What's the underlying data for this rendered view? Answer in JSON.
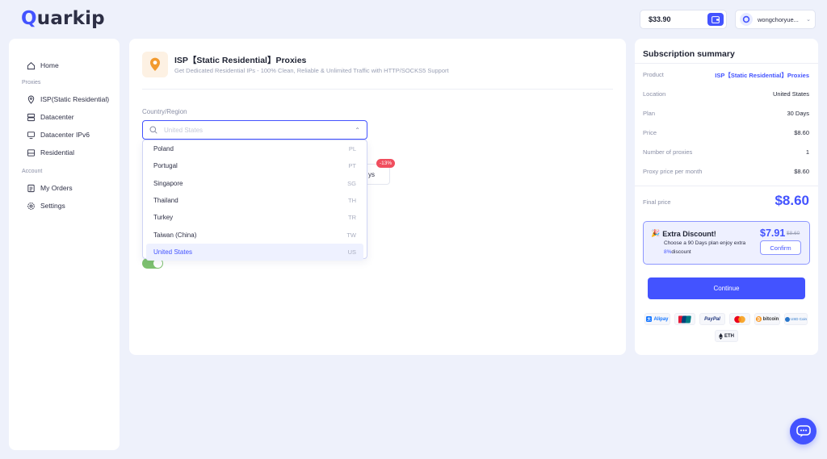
{
  "brand": {
    "logo_first": "Q",
    "logo_rest": "uarkip"
  },
  "header": {
    "balance": "$33.90",
    "username": "wongchoryue..."
  },
  "sidebar": {
    "home": "Home",
    "proxies_section": "Proxies",
    "isp": "ISP(Static Residential)",
    "datacenter": "Datacenter",
    "datacenter_ipv6": "Datacenter IPv6",
    "residential": "Residential",
    "account_section": "Account",
    "orders": "My Orders",
    "settings": "Settings"
  },
  "product": {
    "title": "ISP【Static Residential】Proxies",
    "subtitle": "Get Dedicated Residential IPs - 100% Clean, Reliable & Unlimited Traffic with HTTP/SOCKS5 Support"
  },
  "country": {
    "label": "Country/Region",
    "placeholder": "United States",
    "options": [
      {
        "name": "Poland",
        "code": "PL"
      },
      {
        "name": "Portugal",
        "code": "PT"
      },
      {
        "name": "Singapore",
        "code": "SG"
      },
      {
        "name": "Thailand",
        "code": "TH"
      },
      {
        "name": "Turkey",
        "code": "TR"
      },
      {
        "name": "Taiwan (China)",
        "code": "TW"
      },
      {
        "name": "United States",
        "code": "US"
      }
    ],
    "selected": "US"
  },
  "plan_card": {
    "label_partial": "ys",
    "badge": "-13%"
  },
  "toggle": {
    "on": true
  },
  "summary": {
    "title": "Subscription summary",
    "rows": {
      "product": {
        "k": "Product",
        "v": "ISP【Static Residential】Proxies"
      },
      "location": {
        "k": "Location",
        "v": "United States"
      },
      "plan": {
        "k": "Plan",
        "v": "30 Days"
      },
      "price": {
        "k": "Price",
        "v": "$8.60"
      },
      "num": {
        "k": "Number of proxies",
        "v": "1"
      },
      "ppm": {
        "k": "Proxy price per month",
        "v": "$8.60"
      }
    },
    "final_k": "Final price",
    "final_v": "$8.60"
  },
  "discount": {
    "title": "Extra Discount!",
    "line1": "Choose a 90 Days plan enjoy extra",
    "pct": "8%",
    "line2_rest": "discount",
    "price": "$7.91",
    "old_price": "$8.60",
    "confirm": "Confirm"
  },
  "continue_label": "Continue",
  "payments": {
    "alipay": "Alipay",
    "paypal": "PayPal",
    "bitcoin": "bitcoin",
    "usdcoin": "USD Coin",
    "eth": "ETH"
  },
  "colors": {
    "accent": "#4353ff",
    "badge": "#f04e5e",
    "toggle": "#7ec26f"
  }
}
